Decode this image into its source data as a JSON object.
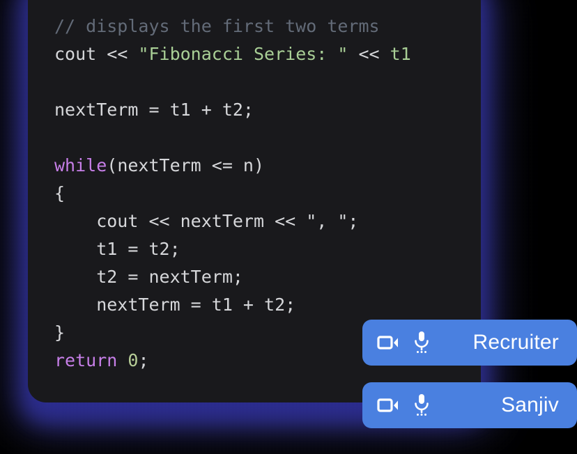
{
  "window": {
    "background": "#000000",
    "title": "Code editor with video call participants"
  },
  "code_card": {
    "background": "#19191c",
    "glow_color": "#3a3bb5",
    "language": "cpp",
    "colors": {
      "default": "#d6d7da",
      "comment": "#636b78",
      "keyword": "#c77fe8",
      "string": "#a9cf96",
      "number": "#b8cf98"
    },
    "lines": [
      {
        "id": "l1",
        "tokens": [
          {
            "t": "// displays the first two terms",
            "c": "com"
          }
        ]
      },
      {
        "id": "l2",
        "tokens": [
          {
            "t": "cout << ",
            "c": "def"
          },
          {
            "t": "\"Fibonacci Series: \"",
            "c": "str"
          },
          {
            "t": " << ",
            "c": "def"
          },
          {
            "t": "t1",
            "c": "var"
          }
        ]
      },
      {
        "id": "l3",
        "tokens": []
      },
      {
        "id": "l4",
        "tokens": [
          {
            "t": "nextTerm = t1 + t2;",
            "c": "def"
          }
        ]
      },
      {
        "id": "l5",
        "tokens": []
      },
      {
        "id": "l6",
        "tokens": [
          {
            "t": "while",
            "c": "key"
          },
          {
            "t": "(nextTerm <= n)",
            "c": "def"
          }
        ]
      },
      {
        "id": "l7",
        "tokens": [
          {
            "t": "{",
            "c": "def"
          }
        ]
      },
      {
        "id": "l8",
        "tokens": [
          {
            "t": "    cout << nextTerm << \", \";",
            "c": "def"
          }
        ]
      },
      {
        "id": "l9",
        "tokens": [
          {
            "t": "    t1 = t2;",
            "c": "def"
          }
        ]
      },
      {
        "id": "l10",
        "tokens": [
          {
            "t": "    t2 = nextTerm;",
            "c": "def"
          }
        ]
      },
      {
        "id": "l11",
        "tokens": [
          {
            "t": "    nextTerm = t1 + t2;",
            "c": "def"
          }
        ]
      },
      {
        "id": "l12",
        "tokens": [
          {
            "t": "}",
            "c": "def"
          }
        ]
      },
      {
        "id": "l13",
        "tokens": [
          {
            "t": "return",
            "c": "key"
          },
          {
            "t": " ",
            "c": "def"
          },
          {
            "t": "0",
            "c": "num"
          },
          {
            "t": ";",
            "c": "def"
          }
        ]
      }
    ]
  },
  "call_buttons": {
    "accent_color": "#4a80e0",
    "label_color": "#ffffff",
    "items": [
      {
        "id": "recruiter",
        "label": "Recruiter",
        "video_icon": "video-camera-icon",
        "mic_icon": "microphone-icon"
      },
      {
        "id": "sanjiv",
        "label": "Sanjiv",
        "video_icon": "video-camera-icon",
        "mic_icon": "microphone-icon"
      }
    ]
  }
}
